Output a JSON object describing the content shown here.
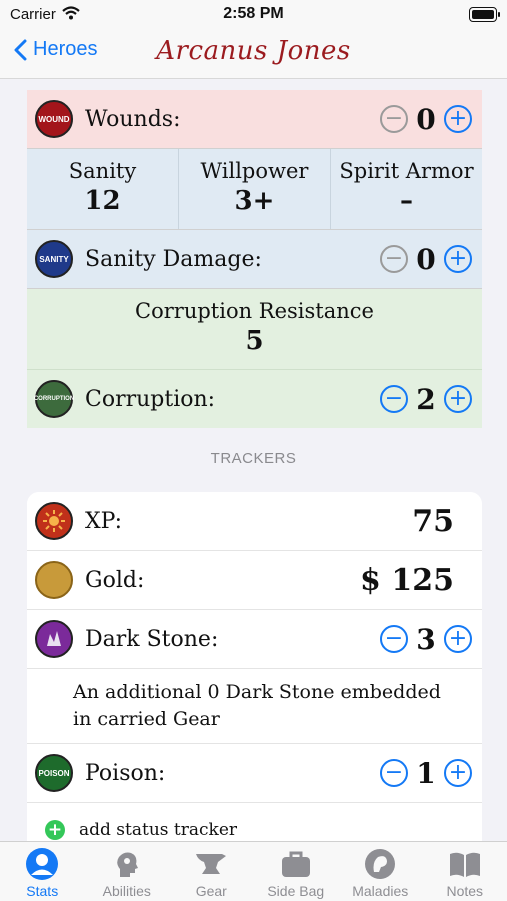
{
  "status_bar": {
    "carrier": "Carrier",
    "time": "2:58 PM"
  },
  "nav": {
    "back_label": "Heroes",
    "title": "Arcanus Jones"
  },
  "health": {
    "wounds": {
      "icon_text": "WOUND",
      "label": "Wounds:",
      "value": "0",
      "color": "#a3151b"
    }
  },
  "sanity": {
    "stats": [
      {
        "label": "Sanity",
        "value": "12"
      },
      {
        "label": "Willpower",
        "value": "3+"
      },
      {
        "label": "Spirit Armor",
        "value": "–"
      }
    ],
    "damage": {
      "icon_text": "SANITY",
      "label": "Sanity Damage:",
      "value": "0",
      "color": "#1f3a8a"
    }
  },
  "corruption": {
    "resistance_label": "Corruption Resistance",
    "resistance_value": "5",
    "tracker": {
      "icon_text": "CORRUPTION",
      "label": "Corruption:",
      "value": "2",
      "color": "#3d6b3d"
    }
  },
  "trackers": {
    "section_title": "TRACKERS",
    "items": [
      {
        "label": "XP:",
        "value": "75",
        "icon": "xp-icon",
        "color": "#c0301a"
      },
      {
        "label": "Gold:",
        "value": "$ 125",
        "icon": "gold-coin-icon",
        "color": "#c89a3a"
      },
      {
        "label": "Dark Stone:",
        "value": "3",
        "icon": "dark-stone-icon",
        "color": "#7b2a9a"
      },
      {
        "label": "Poison:",
        "value": "1",
        "icon_text": "POISON",
        "color": "#1e6b2c"
      }
    ],
    "dark_stone_note": "An additional 0 Dark Stone embedded in carried Gear",
    "add_label": "add status tracker"
  },
  "tabs": [
    {
      "label": "Stats",
      "icon": "person-icon",
      "active": true
    },
    {
      "label": "Abilities",
      "icon": "head-gear-icon",
      "active": false
    },
    {
      "label": "Gear",
      "icon": "anvil-icon",
      "active": false
    },
    {
      "label": "Side Bag",
      "icon": "bag-icon",
      "active": false
    },
    {
      "label": "Maladies",
      "icon": "malady-icon",
      "active": false
    },
    {
      "label": "Notes",
      "icon": "book-icon",
      "active": false
    }
  ],
  "colors": {
    "accent": "#1479f5",
    "title": "#9b1b1f"
  }
}
